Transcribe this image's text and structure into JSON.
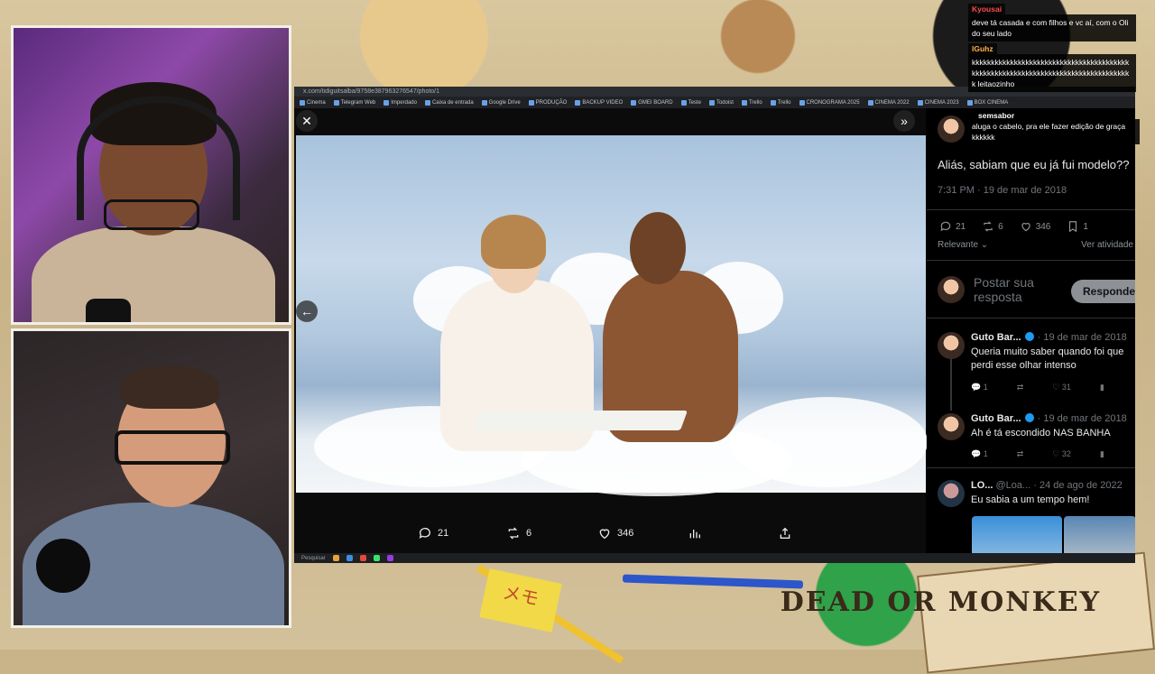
{
  "browser": {
    "url": "x.com/tidiguitsalba/9758e387963276547/photo/1",
    "bookmarks": [
      "Cinema",
      "Telegram Web",
      "Imperdado",
      "Caixa de entrada",
      "Google Drive",
      "PRODUÇÃO",
      "BACKUP VIDEO",
      "GMEI BOARD",
      "Teste",
      "Todoist",
      "Trello",
      "Trello",
      "CRONOGRAMA 2025",
      "CINEMA 2022",
      "CINEMA 2023",
      "BOX CINEMA"
    ],
    "taskbar_search": "Pesquisar"
  },
  "viewer": {
    "close_icon": "close-icon",
    "expand_icon": "double-chevron-right-icon",
    "prev_icon": "arrow-left-icon",
    "actions": {
      "replies": "21",
      "reposts": "6",
      "likes": "346"
    }
  },
  "sidebar": {
    "tweet_text": "Aliás, sabiam que eu já fui modelo??",
    "timestamp": "7:31 PM · 19 de mar de 2018",
    "stats": {
      "replies": "21",
      "reposts": "6",
      "likes": "346",
      "bookmarks": "1"
    },
    "sort_label": "Relevante",
    "activity_link": "Ver atividade",
    "reply_placeholder": "Postar sua resposta",
    "reply_button": "Responder",
    "comments": [
      {
        "name": "Guto Bar...",
        "meta": "· 19 de mar de 2018",
        "text": "Queria muito saber quando foi que perdi esse olhar intenso",
        "replies": "1",
        "likes": "31"
      },
      {
        "name": "Guto Bar...",
        "meta": "· 19 de mar de 2018",
        "text": "Ah é tá escondido NAS BANHA",
        "replies": "1",
        "likes": "32"
      },
      {
        "name": "LO...",
        "meta": "@Loa... · 24 de ago de 2022",
        "text": "Eu sabia a um tempo hem!"
      }
    ]
  },
  "chat": {
    "messages": [
      {
        "user": "Kyousai",
        "text": "deve tá casada e com filhos e vc aí, com o Oli do seu lado"
      },
      {
        "user": "lGuhz",
        "text": "kkkkkkkkkkkkkkkkkkkkkkkkkkkkkkkkkkkkkkkkkkkkkkkkkkkkkkkkkkkkkkkkkkkkkkkkkkkkkkkkkkk leitaozinho"
      },
      {
        "user": "semsabor",
        "text": "aluga o cabelo, pra ele fazer edição de graça kkkkkk"
      }
    ]
  },
  "background": {
    "poster_text": "DEAD OR MONKEY",
    "sticky_text": "メモ"
  }
}
